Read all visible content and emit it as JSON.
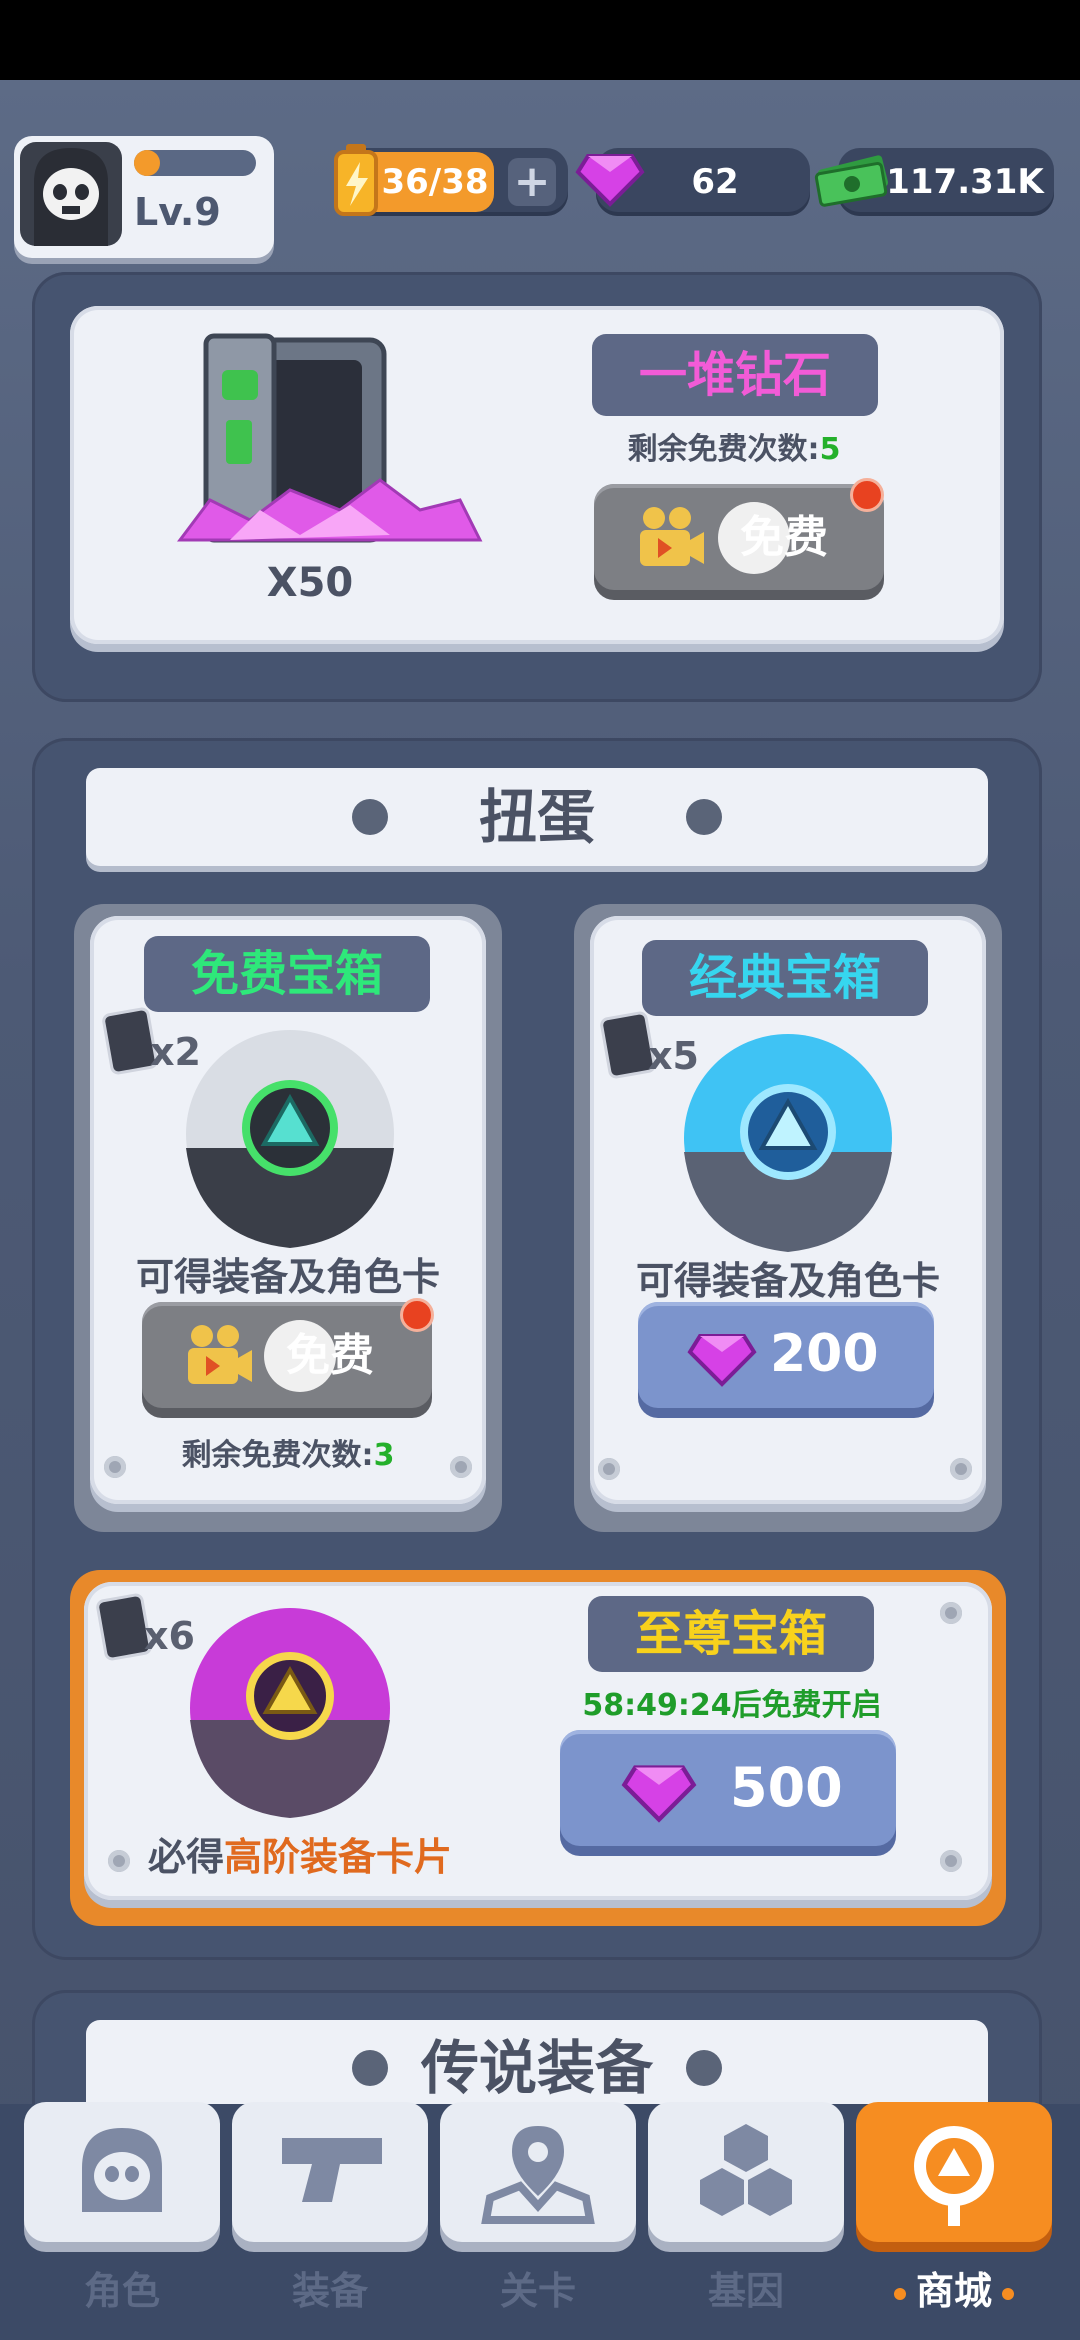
{
  "player": {
    "level": "Lv.9",
    "xp_fraction": 0.05
  },
  "resources": {
    "energy": "36/38",
    "gems": "62",
    "cash": "117.31K"
  },
  "diamond_offer": {
    "title": "一堆钻石",
    "quantity": "X50",
    "remaining_label": "剩余免费次数:",
    "remaining_count": "5",
    "button_label": "免费"
  },
  "gacha": {
    "section_title": "扭蛋",
    "free_box": {
      "title": "免费宝箱",
      "card_count": "x2",
      "description": "可得装备及角色卡片",
      "button_label": "免费",
      "remaining_label": "剩余免费次数:",
      "remaining_count": "3"
    },
    "classic_box": {
      "title": "经典宝箱",
      "card_count": "x5",
      "description": "可得装备及角色卡片",
      "price": "200"
    },
    "supreme_box": {
      "title": "至尊宝箱",
      "card_count": "x6",
      "timer_text": "58:49:24后免费开启",
      "description_prefix": "必得",
      "description_highlight": "高阶装备卡片",
      "price": "500"
    }
  },
  "legendary_section": {
    "title": "传说装备"
  },
  "nav": {
    "items": [
      {
        "label": "角色",
        "icon": "skull-icon"
      },
      {
        "label": "装备",
        "icon": "gun-icon"
      },
      {
        "label": "关卡",
        "icon": "map-pin-icon"
      },
      {
        "label": "基因",
        "icon": "hexagons-icon"
      },
      {
        "label": "商城",
        "icon": "shop-icon",
        "active": true
      }
    ]
  },
  "colors": {
    "accent_orange": "#f68d21",
    "gem_pink": "#c02ee0",
    "free_title_green": "#2ee87a",
    "classic_title_cyan": "#36d6ef",
    "supreme_title_yellow": "#f8d21c",
    "diamond_title_pink": "#f25bd7"
  }
}
